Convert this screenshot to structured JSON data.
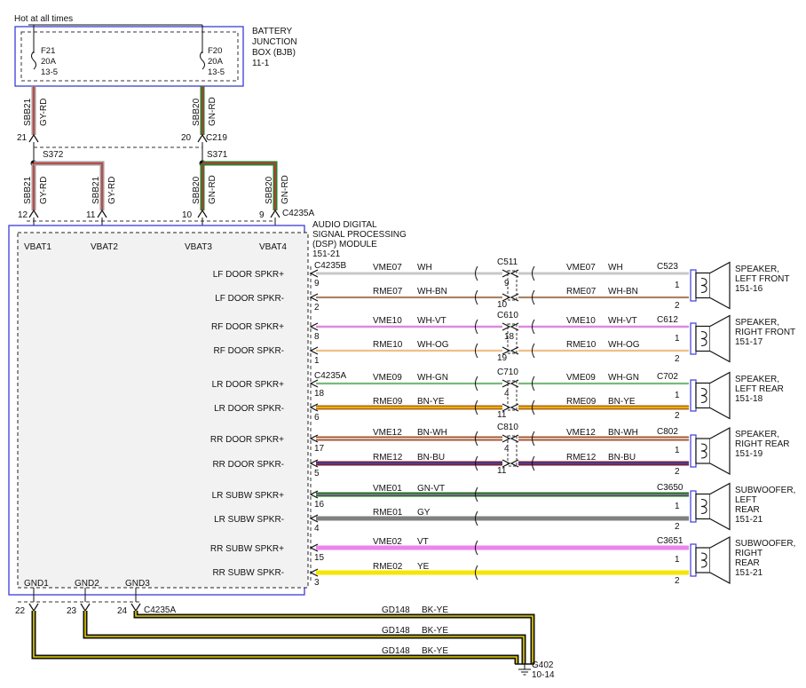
{
  "hot_label": "Hot at all times",
  "bjb": {
    "title_lines": [
      "BATTERY",
      "JUNCTION",
      "BOX (BJB)",
      "11-1"
    ],
    "fuse_left": {
      "lines": [
        "F21",
        "20A",
        "13-5"
      ]
    },
    "fuse_right": {
      "lines": [
        "F20",
        "20A",
        "13-5"
      ]
    }
  },
  "upper_wires": {
    "left": {
      "circuit": "SBB21",
      "color": "GY-RD",
      "pin": "21"
    },
    "right": {
      "circuit": "SBB20",
      "color": "GN-RD",
      "pin": "20"
    },
    "connector": "C219"
  },
  "splices": {
    "left": "S372",
    "right": "S371"
  },
  "lower_wires": [
    {
      "circuit": "SBB21",
      "color": "GY-RD",
      "pin": "12"
    },
    {
      "circuit": "SBB21",
      "color": "GY-RD",
      "pin": "11"
    },
    {
      "circuit": "SBB20",
      "color": "GN-RD",
      "pin": "10"
    },
    {
      "circuit": "SBB20",
      "color": "GN-RD",
      "pin": "9"
    }
  ],
  "lower_connector": "C4235A",
  "module": {
    "title_lines": [
      "AUDIO DIGITAL",
      "SIGNAL PROCESSING",
      "(DSP) MODULE",
      "151-21"
    ],
    "vbat_labels": [
      "VBAT1",
      "VBAT2",
      "VBAT3",
      "VBAT4"
    ],
    "gnd_labels": [
      "GND1",
      "GND2",
      "GND3"
    ],
    "outputs": [
      "LF DOOR SPKR+",
      "LF DOOR SPKR-",
      "RF DOOR SPKR+",
      "RF DOOR SPKR-",
      "LR DOOR SPKR+",
      "LR DOOR SPKR-",
      "RR DOOR SPKR+",
      "RR DOOR SPKR-",
      "LR SUBW SPKR+",
      "LR SUBW SPKR-",
      "RR SUBW SPKR+",
      "RR SUBW SPKR-"
    ]
  },
  "speaker_groups": [
    {
      "module_conn": "C4235B",
      "inline_conn": "C511",
      "spk_conn": "C523",
      "speaker_lines": [
        "SPEAKER,",
        "LEFT FRONT",
        "151-16"
      ],
      "wires": [
        {
          "pin": "9",
          "circuit": "VME07",
          "color": "WH",
          "inline_pin_a": "9",
          "inline_pin_b": "",
          "spk_pin": "1",
          "main": "#c8c8c8",
          "stripe": ""
        },
        {
          "pin": "2",
          "circuit": "RME07",
          "color": "WH-BN",
          "inline_pin_a": "10",
          "inline_pin_b": "",
          "spk_pin": "2",
          "main": "#e9e9e9",
          "stripe": "#8b4513"
        }
      ]
    },
    {
      "module_conn": "",
      "inline_conn": "C610",
      "spk_conn": "C612",
      "speaker_lines": [
        "SPEAKER,",
        "RIGHT FRONT",
        "151-17"
      ],
      "wires": [
        {
          "pin": "8",
          "circuit": "VME10",
          "color": "WH-VT",
          "inline_pin_a": "18",
          "inline_pin_b": "",
          "spk_pin": "1",
          "main": "#f2c9f2",
          "stripe": "#cc66cc"
        },
        {
          "pin": "1",
          "circuit": "RME10",
          "color": "WH-OG",
          "inline_pin_a": "19",
          "inline_pin_b": "",
          "spk_pin": "2",
          "main": "#f3efe0",
          "stripe": "#f0a050"
        }
      ]
    },
    {
      "module_conn": "C4235A",
      "inline_conn": "C710",
      "spk_conn": "C702",
      "speaker_lines": [
        "SPEAKER,",
        "LEFT REAR",
        "151-18"
      ],
      "wires": [
        {
          "pin": "18",
          "circuit": "VME09",
          "color": "WH-GN",
          "inline_pin_a": "4",
          "inline_pin_b": "",
          "spk_pin": "1",
          "main": "#dfeedd",
          "stripe": "#3c9a3c"
        },
        {
          "pin": "6",
          "circuit": "RME09",
          "color": "BN-YE",
          "inline_pin_a": "11",
          "inline_pin_b": "",
          "spk_pin": "2",
          "main": "#b5651d",
          "stripe": "#ffe000"
        }
      ]
    },
    {
      "module_conn": "",
      "inline_conn": "C810",
      "spk_conn": "C802",
      "speaker_lines": [
        "SPEAKER,",
        "RIGHT REAR",
        "151-19"
      ],
      "wires": [
        {
          "pin": "17",
          "circuit": "VME12",
          "color": "BN-WH",
          "inline_pin_a": "4",
          "inline_pin_b": "",
          "spk_pin": "1",
          "main": "#a0522d",
          "stripe": "#ffffff"
        },
        {
          "pin": "5",
          "circuit": "RME12",
          "color": "BN-BU",
          "inline_pin_a": "11",
          "inline_pin_b": "",
          "spk_pin": "2",
          "main": "#7a1f3d",
          "stripe": "#3050c0"
        }
      ]
    },
    {
      "module_conn": "",
      "inline_conn": "",
      "spk_conn": "C3650",
      "speaker_lines": [
        "SUBWOOFER,",
        "LEFT",
        "REAR",
        "151-21"
      ],
      "wires": [
        {
          "pin": "16",
          "circuit": "VME01",
          "color": "GN-VT",
          "inline_pin_a": "",
          "inline_pin_b": "",
          "spk_pin": "1",
          "main": "#1e6e1e",
          "stripe": "#b070d0"
        },
        {
          "pin": "4",
          "circuit": "RME01",
          "color": "GY",
          "inline_pin_a": "",
          "inline_pin_b": "",
          "spk_pin": "2",
          "main": "#808080",
          "stripe": ""
        }
      ]
    },
    {
      "module_conn": "",
      "inline_conn": "",
      "spk_conn": "C3651",
      "speaker_lines": [
        "SUBWOOFER,",
        "RIGHT",
        "REAR",
        "151-21"
      ],
      "wires": [
        {
          "pin": "15",
          "circuit": "VME02",
          "color": "VT",
          "inline_pin_a": "",
          "inline_pin_b": "",
          "spk_pin": "1",
          "main": "#ee82ee",
          "stripe": ""
        },
        {
          "pin": "3",
          "circuit": "RME02",
          "color": "YE",
          "inline_pin_a": "",
          "inline_pin_b": "",
          "spk_pin": "2",
          "main": "#f5e600",
          "stripe": ""
        }
      ]
    }
  ],
  "grounds": {
    "connector": "C4235A",
    "pins": [
      "22",
      "23",
      "24"
    ],
    "wires": [
      {
        "circuit": "GD148",
        "color": "BK-YE"
      },
      {
        "circuit": "GD148",
        "color": "BK-YE"
      },
      {
        "circuit": "GD148",
        "color": "BK-YE"
      }
    ],
    "ground_point": [
      "G402",
      "10-14"
    ]
  },
  "colors": {
    "frame_blue": "#3c3cd8",
    "module_fill": "#f2f2f2",
    "gy_rd_main": "#9a9a9a",
    "gy_rd_stripe": "#d03030",
    "gn_rd_main": "#2e7d32",
    "gn_rd_stripe": "#d03030",
    "bk": "#111111",
    "ye": "#e6d200"
  }
}
